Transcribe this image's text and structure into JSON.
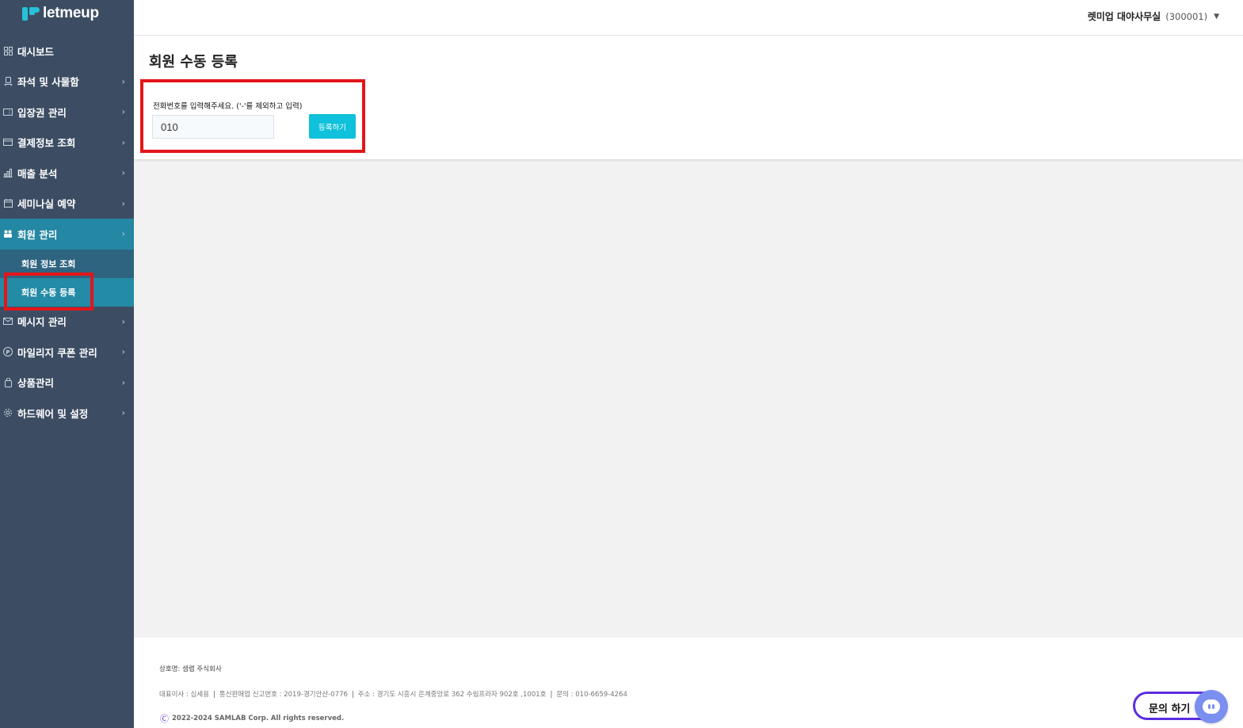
{
  "brand": {
    "name": "letmeup"
  },
  "header": {
    "store_name": "렛미업 대야사무실",
    "store_id": "(300001)"
  },
  "sidebar": {
    "items": [
      {
        "label": "대시보드",
        "icon": "grid-icon",
        "has_chevron": false
      },
      {
        "label": "좌석 및 사물함",
        "icon": "seat-icon",
        "has_chevron": true
      },
      {
        "label": "입장권 관리",
        "icon": "ticket-icon",
        "has_chevron": true
      },
      {
        "label": "결제정보 조회",
        "icon": "card-icon",
        "has_chevron": true
      },
      {
        "label": "매출 분석",
        "icon": "bar-chart-icon",
        "has_chevron": true
      },
      {
        "label": "세미나실 예약",
        "icon": "calendar-icon",
        "has_chevron": true
      },
      {
        "label": "회원 관리",
        "icon": "users-icon",
        "has_chevron": true,
        "active": true
      },
      {
        "label": "메시지 관리",
        "icon": "mail-icon",
        "has_chevron": true
      },
      {
        "label": "마일리지 쿠폰 관리",
        "icon": "p-coin-icon",
        "has_chevron": true
      },
      {
        "label": "상품관리",
        "icon": "bag-icon",
        "has_chevron": true
      },
      {
        "label": "하드웨어 및 설정",
        "icon": "gear-icon",
        "has_chevron": true
      }
    ],
    "submenu": [
      {
        "label": "회원 정보 조회"
      },
      {
        "label": "회원 수동 등록",
        "active": true
      }
    ]
  },
  "main": {
    "title": "회원 수동 등록",
    "form": {
      "label": "전화번호를 입력해주세요. ('-'를 제외하고 입력)",
      "phone_value": "010",
      "submit_label": "등록하기"
    }
  },
  "footer": {
    "company": "상호명: 샘랩 주식회사",
    "ceo": "대표이사 : 심세용",
    "registration": "통신판매업 신고번호 : 2019-경기안산-0776",
    "address": "주소 : 경기도 시흥시 은계중앙로 362 수림프라자 902호 ,1001호",
    "contact": "문의 : 010-6659-4264",
    "copyright": "2022-2024 SAMLAB Corp. All rights reserved.",
    "copyright_symbol": "Ⓒ"
  },
  "chat": {
    "label": "문의 하기"
  },
  "colors": {
    "sidebar_bg": "#3c4d63",
    "active_menu": "#2487a3",
    "accent": "#0fc1da",
    "highlight": "#e3151b",
    "chat_border": "#5b2ee0"
  }
}
